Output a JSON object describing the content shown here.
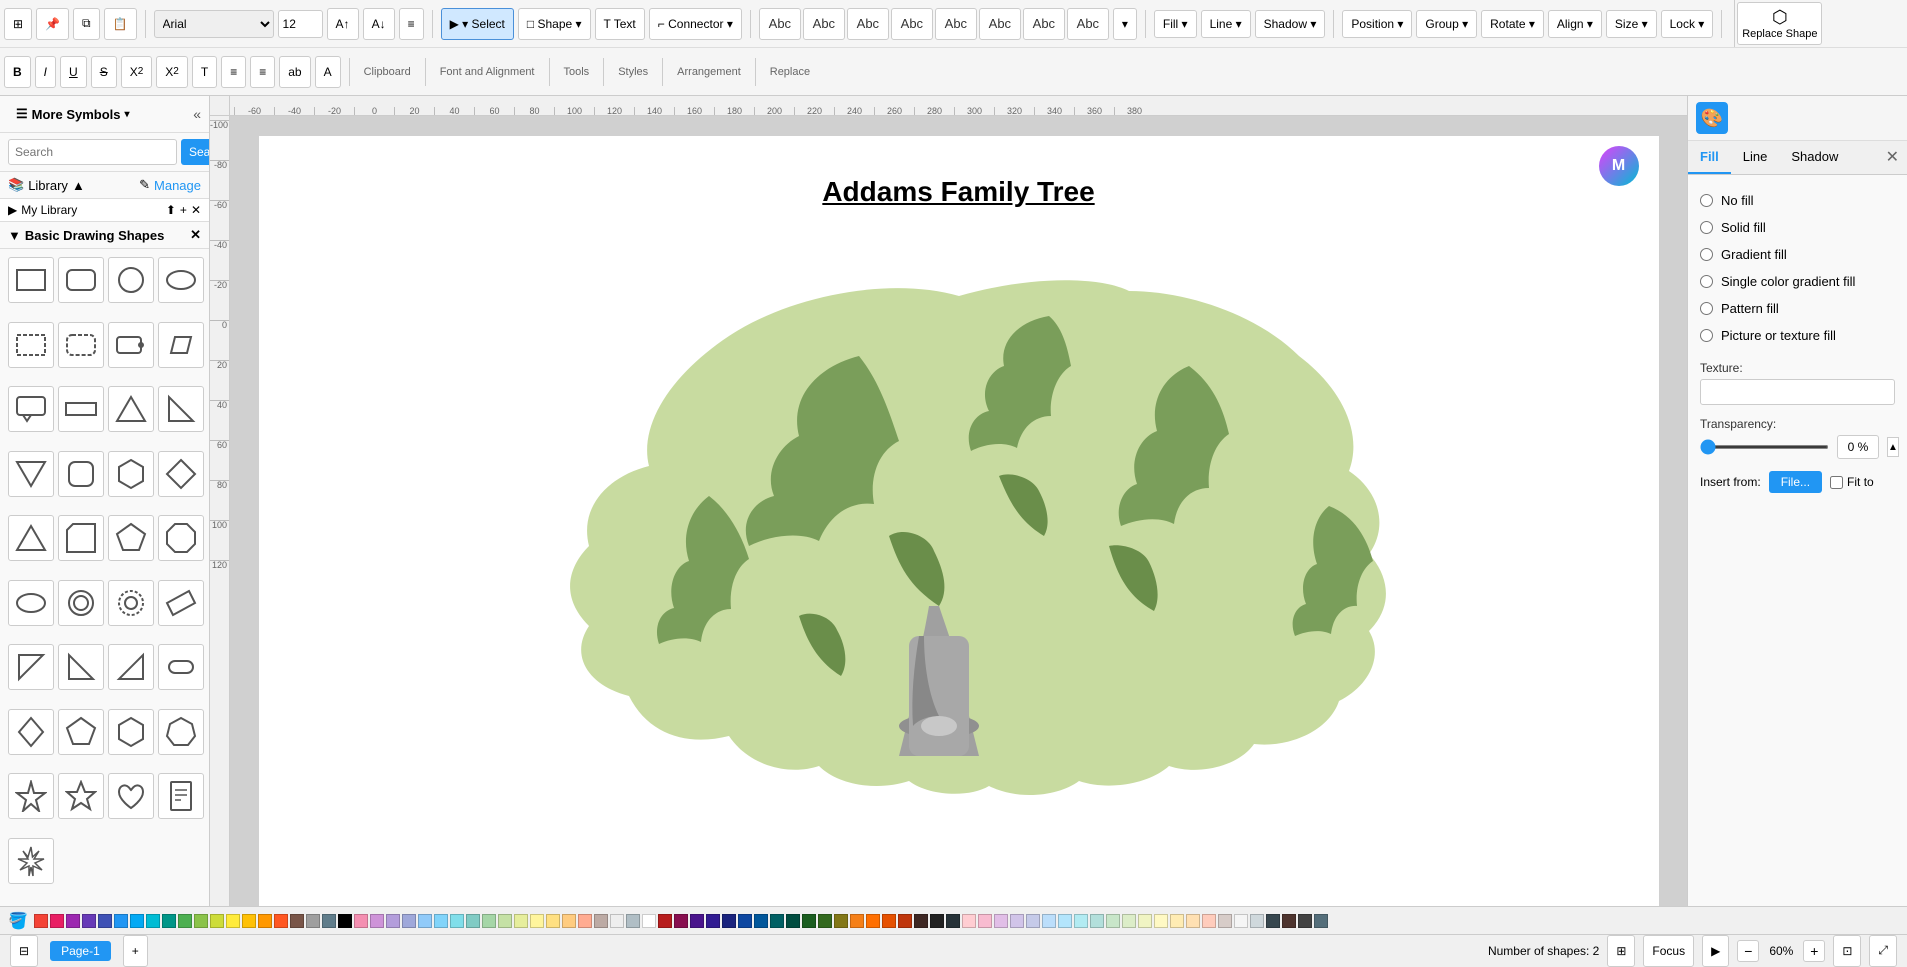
{
  "toolbar": {
    "row1": {
      "clipboard_label": "Clipboard",
      "font_label": "Font and Alignment",
      "font_name": "Arial",
      "font_size": "12",
      "tools_label": "Tools",
      "select_btn": "▾ Select",
      "shape_btn": "□ Shape ▾",
      "text_btn": "T Text",
      "connector_btn": "⌐ Connector ▾",
      "styles_label": "Styles",
      "arrangement_label": "Arrangement",
      "replace_label": "Replace",
      "replace_shape_btn": "Replace Shape",
      "fill_btn": "Fill ▾",
      "line_btn": "Line ▾",
      "shadow_btn": "Shadow ▾",
      "position_btn": "Position ▾",
      "group_btn": "Group ▾",
      "rotate_btn": "Rotate ▾",
      "align_btn": "Align ▾",
      "size_btn": "Size ▾",
      "lock_btn": "Lock ▾"
    },
    "row2": {
      "bold": "B",
      "italic": "I",
      "underline": "U",
      "strikethrough": "S",
      "superscript": "X²",
      "subscript": "X₂",
      "text_format": "T",
      "list": "≡",
      "list2": "≡",
      "color": "A",
      "bgcolor": "ab"
    },
    "abc_styles": [
      "Abc",
      "Abc",
      "Abc",
      "Abc",
      "Abc",
      "Abc",
      "Abc",
      "Abc"
    ]
  },
  "left_panel": {
    "more_symbols": "More Symbols",
    "search_placeholder": "Search",
    "search_btn": "Search",
    "library_label": "Library",
    "manage_label": "Manage",
    "my_library": "My Library",
    "basic_drawing": "Basic Drawing Shapes"
  },
  "canvas": {
    "title": "Addams Family Tree",
    "page_name": "Page-1"
  },
  "right_panel": {
    "tabs": [
      "Fill",
      "Line",
      "Shadow"
    ],
    "active_tab": "Fill",
    "fill_options": [
      "No fill",
      "Solid fill",
      "Gradient fill",
      "Single color gradient fill",
      "Pattern fill",
      "Picture or texture fill"
    ],
    "texture_label": "Texture:",
    "transparency_label": "Transparency:",
    "transparency_value": "0 %",
    "insert_from_label": "Insert from:",
    "file_btn": "File...",
    "fit_to_label": "Fit to"
  },
  "bottom_bar": {
    "page_tab": "Page-1",
    "add_page": "+",
    "num_shapes": "Number of shapes: 2",
    "focus_btn": "Focus",
    "zoom_minus": "−",
    "zoom_plus": "+",
    "zoom_value": "60%",
    "fit_btn": "⊡",
    "expand_btn": "⤢"
  },
  "colors": [
    "#f44336",
    "#e91e63",
    "#9c27b0",
    "#673ab7",
    "#3f51b5",
    "#2196f3",
    "#03a9f4",
    "#00bcd4",
    "#009688",
    "#4caf50",
    "#8bc34a",
    "#cddc39",
    "#ffeb3b",
    "#ffc107",
    "#ff9800",
    "#ff5722",
    "#795548",
    "#9e9e9e",
    "#607d8b",
    "#000000",
    "#f48fb1",
    "#ce93d8",
    "#b39ddb",
    "#9fa8da",
    "#90caf9",
    "#81d4fa",
    "#80deea",
    "#80cbc4",
    "#a5d6a7",
    "#c5e1a5",
    "#e6ee9c",
    "#fff59d",
    "#ffe082",
    "#ffcc80",
    "#ffab91",
    "#bcaaa4",
    "#eeeeee",
    "#b0bec5",
    "#ffffff",
    "#b71c1c",
    "#880e4f",
    "#4a148c",
    "#311b92",
    "#1a237e",
    "#0d47a1",
    "#01579b",
    "#006064",
    "#004d40",
    "#1b5e20",
    "#33691e",
    "#827717",
    "#f57f17",
    "#ff6f00",
    "#e65100",
    "#bf360c",
    "#3e2723",
    "#212121",
    "#263238",
    "#ffcdd2",
    "#f8bbd0",
    "#e1bee7",
    "#d1c4e9",
    "#c5cae9",
    "#bbdefb",
    "#b3e5fc",
    "#b2ebf2",
    "#b2dfdb",
    "#c8e6c9",
    "#dcedc8",
    "#f0f4c3",
    "#fff9c4",
    "#ffecb3",
    "#ffe0b2",
    "#ffccbc",
    "#d7ccc8",
    "#f5f5f5",
    "#cfd8dc",
    "#37474f",
    "#4e342e",
    "#424242",
    "#546e7a"
  ]
}
